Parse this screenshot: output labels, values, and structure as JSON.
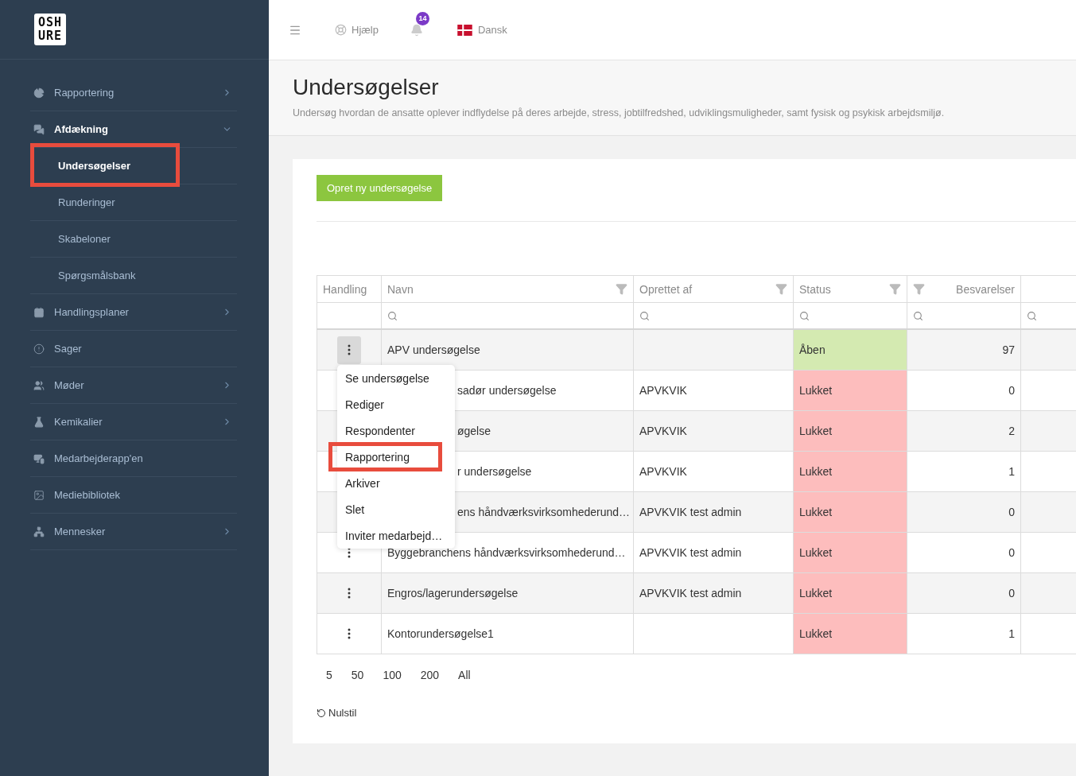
{
  "logo": {
    "line_1": "OSH",
    "line_2": "URE"
  },
  "sidebar": {
    "items": [
      {
        "label": "Rapportering",
        "kind": "group",
        "expanded": false,
        "active": false
      },
      {
        "label": "Afdækning",
        "kind": "group",
        "expanded": true,
        "active": true,
        "children": [
          {
            "label": "Undersøgelser",
            "selected": true,
            "highlighted": true
          },
          {
            "label": "Runderinger",
            "selected": false,
            "highlighted": false
          },
          {
            "label": "Skabeloner",
            "selected": false,
            "highlighted": false
          },
          {
            "label": "Spørgsmålsbank",
            "selected": false,
            "highlighted": false
          }
        ]
      },
      {
        "label": "Handlingsplaner",
        "kind": "group",
        "expanded": false,
        "active": false
      },
      {
        "label": "Sager",
        "kind": "link",
        "active": false
      },
      {
        "label": "Møder",
        "kind": "group",
        "expanded": false,
        "active": false
      },
      {
        "label": "Kemikalier",
        "kind": "group",
        "expanded": false,
        "active": false
      },
      {
        "label": "Medarbejderapp'en",
        "kind": "link",
        "active": false
      },
      {
        "label": "Mediebibliotek",
        "kind": "link",
        "active": false
      },
      {
        "label": "Mennesker",
        "kind": "group",
        "expanded": false,
        "active": false
      }
    ]
  },
  "topbar": {
    "help": "Hjælp",
    "notifications": "14",
    "language": "Dansk"
  },
  "page": {
    "title": "Undersøgelser",
    "description": "Undersøg hvordan de ansatte oplever indflydelse på deres arbejde, stress, jobtilfredshed, udviklingsmuligheder, samt fysisk og psykisk arbejdsmiljø."
  },
  "create_button": "Opret ny undersøgelse",
  "table": {
    "columns": [
      {
        "label": "Handling",
        "filterable": false,
        "numeric": false,
        "searchable": false
      },
      {
        "label": "Navn",
        "filterable": true,
        "numeric": false,
        "searchable": true
      },
      {
        "label": "Oprettet af",
        "filterable": true,
        "numeric": false,
        "searchable": true
      },
      {
        "label": "Status",
        "filterable": true,
        "numeric": false,
        "searchable": true
      },
      {
        "label": "Besvarelser",
        "filterable": true,
        "numeric": true,
        "searchable": true
      },
      {
        "filterable": false,
        "numeric": false,
        "searchable": true
      }
    ],
    "rows": [
      {
        "name": "APV undersøgelse",
        "status": "Åben",
        "color": "#d4eab1",
        "responses": "97",
        "menu_open": true,
        "covered": false
      },
      {
        "name": "sadør undersøgelse",
        "created_by": "APVKVIK",
        "status": "Lukket",
        "color": "#fdbdbd",
        "responses": "0",
        "menu_open": false,
        "covered": true
      },
      {
        "name": "øgelse",
        "created_by": "APVKVIK",
        "status": "Lukket",
        "color": "#fdbdbd",
        "responses": "2",
        "menu_open": false,
        "covered": true
      },
      {
        "name": "r undersøgelse",
        "created_by": "APVKVIK",
        "status": "Lukket",
        "color": "#fdbdbd",
        "responses": "1",
        "menu_open": false,
        "covered": true
      },
      {
        "name": "ens håndværksvirksomhederund…",
        "created_by": "APVKVIK test admin",
        "status": "Lukket",
        "color": "#fdbdbd",
        "responses": "0",
        "menu_open": false,
        "covered": true
      },
      {
        "name": "Byggebranchens håndværksvirksomhederund…",
        "created_by": "APVKVIK test admin",
        "status": "Lukket",
        "color": "#fdbdbd",
        "responses": "0",
        "menu_open": false,
        "covered": false
      },
      {
        "name": "Engros/lagerundersøgelse",
        "created_by": "APVKVIK test admin",
        "status": "Lukket",
        "color": "#fdbdbd",
        "responses": "0",
        "menu_open": false,
        "covered": false
      },
      {
        "name": "Kontorundersøgelse1",
        "status": "Lukket",
        "color": "#fdbdbd",
        "responses": "1",
        "menu_open": false,
        "covered": false
      }
    ]
  },
  "action_menu": {
    "items": [
      {
        "label": "Se undersøgelse",
        "highlighted": false
      },
      {
        "label": "Rediger",
        "highlighted": false
      },
      {
        "label": "Respondenter",
        "highlighted": false
      },
      {
        "label": "Rapportering",
        "highlighted": true
      },
      {
        "label": "Arkiver",
        "highlighted": false
      },
      {
        "label": "Slet",
        "highlighted": false
      },
      {
        "label": "Inviter medarbejd…",
        "highlighted": false
      }
    ]
  },
  "page_sizes": [
    "5",
    "50",
    "100",
    "200",
    "All"
  ],
  "reset": "Nulstil"
}
